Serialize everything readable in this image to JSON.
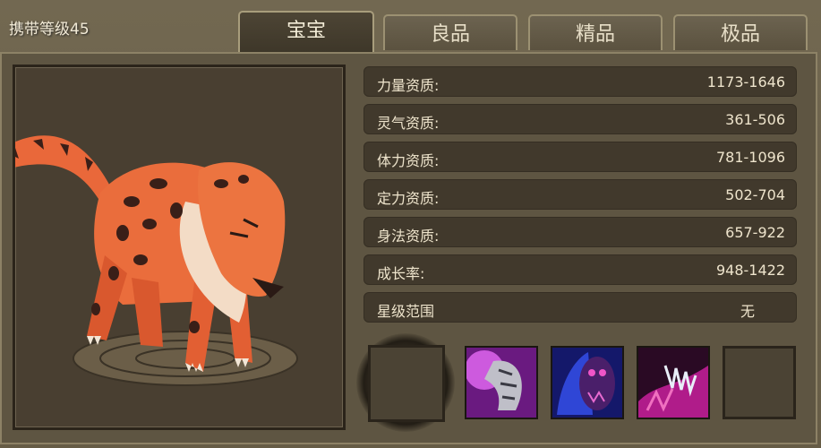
{
  "header": {
    "carry_level": "携带等级45"
  },
  "tabs": [
    {
      "label": "宝宝",
      "active": true
    },
    {
      "label": "良品",
      "active": false
    },
    {
      "label": "精品",
      "active": false
    },
    {
      "label": "极品",
      "active": false
    }
  ],
  "stats": [
    {
      "label": "力量资质:",
      "value": "1173-1646"
    },
    {
      "label": "灵气资质:",
      "value": "361-506"
    },
    {
      "label": "体力资质:",
      "value": "781-1096"
    },
    {
      "label": "定力资质:",
      "value": "502-704"
    },
    {
      "label": "身法资质:",
      "value": "657-922"
    },
    {
      "label": "成长率:",
      "value": "948-1422"
    },
    {
      "label": "星级范围",
      "value": "无"
    }
  ],
  "skills": [
    {
      "name": "empty-skill-slot"
    },
    {
      "name": "claw-strike-skill-icon",
      "color": "#c02fd8"
    },
    {
      "name": "shadow-beast-skill-icon",
      "color": "#3040c0"
    },
    {
      "name": "fang-rush-skill-icon",
      "color": "#b01c8a"
    },
    {
      "name": "empty-skill-slot"
    }
  ],
  "pet": {
    "name": "leopard-pet-model",
    "color": "#e9683a"
  }
}
